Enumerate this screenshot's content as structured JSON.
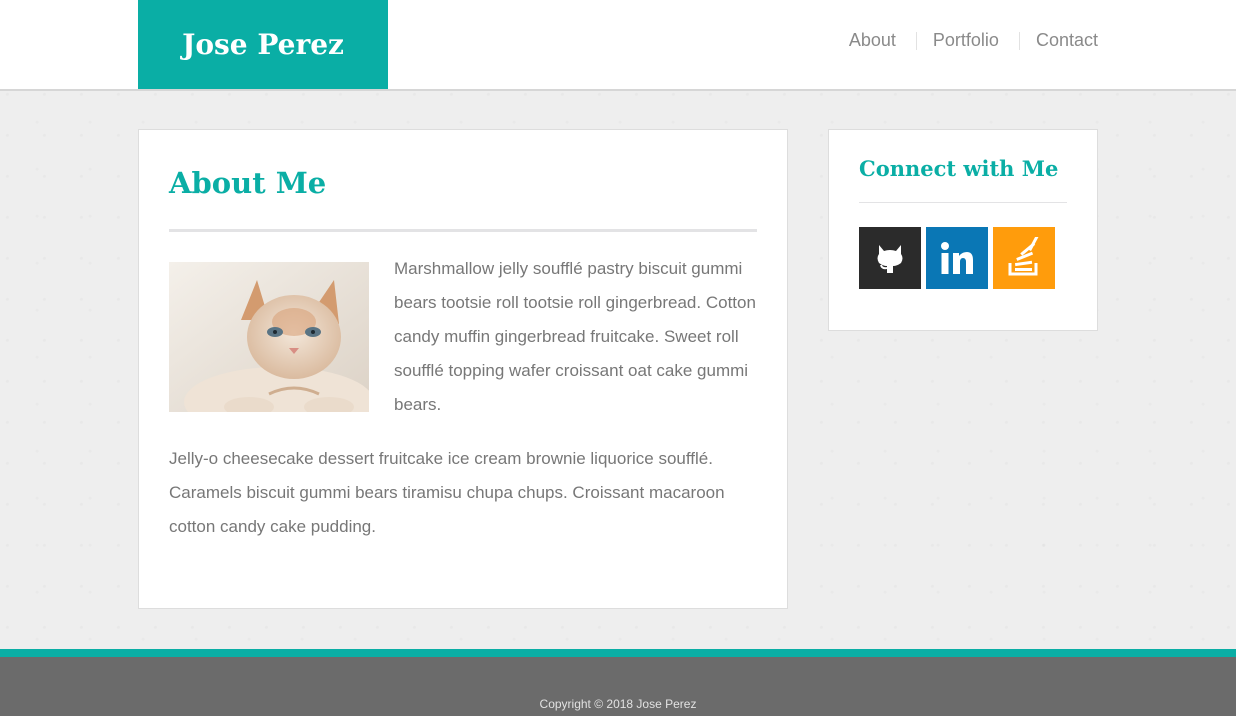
{
  "header": {
    "logo_text": "Jose Perez",
    "nav": [
      {
        "label": "About"
      },
      {
        "label": "Portfolio"
      },
      {
        "label": "Contact"
      }
    ]
  },
  "main": {
    "title": "About Me",
    "paragraph1": "Marshmallow jelly soufflé pastry biscuit gummi bears tootsie roll tootsie roll gingerbread. Cotton candy muffin gingerbread fruitcake. Sweet roll soufflé topping wafer croissant oat cake gummi bears.",
    "paragraph2": "Jelly-o cheesecake dessert fruitcake ice cream brownie liquorice soufflé. Caramels biscuit gummi bears tiramisu chupa chups. Croissant macaroon cotton candy cake pudding.",
    "image": {
      "icon": "cat-photo"
    }
  },
  "sidebar": {
    "title": "Connect with Me",
    "social": [
      {
        "icon": "github-icon",
        "color": "#2b2b2b"
      },
      {
        "icon": "linkedin-icon",
        "color": "#0a77b5"
      },
      {
        "icon": "stackoverflow-icon",
        "color": "#ff9c0c"
      }
    ]
  },
  "footer": {
    "copyright": "Copyright © 2018 Jose Perez"
  },
  "colors": {
    "accent": "#0aaea5",
    "text": "#777777",
    "footer_bg": "#6b6b6b"
  }
}
